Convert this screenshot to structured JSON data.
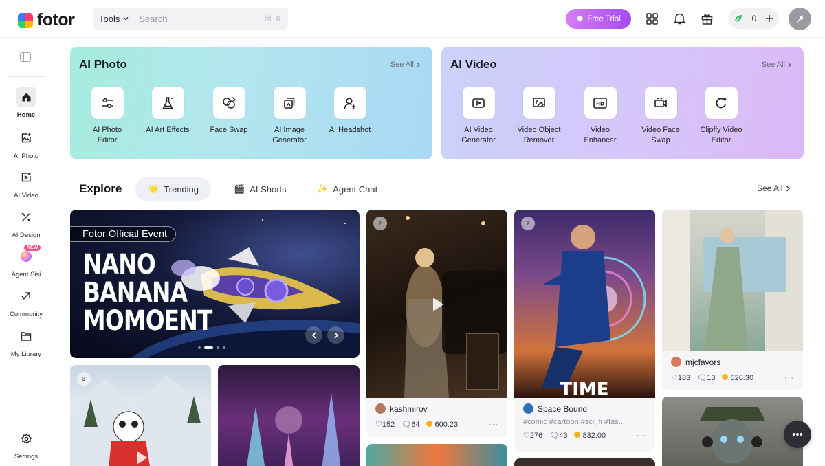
{
  "app": {
    "logo_text": "fotor"
  },
  "topbar": {
    "tools_label": "Tools",
    "search_placeholder": "Search",
    "search_shortcut": "⌘+K",
    "free_trial_label": "Free Trial",
    "credits": "0"
  },
  "sidebar": {
    "items": [
      {
        "label": "Home",
        "icon": "home-icon",
        "active": true
      },
      {
        "label": "AI Photo",
        "icon": "image-plus-icon"
      },
      {
        "label": "AI Video",
        "icon": "video-plus-icon"
      },
      {
        "label": "AI Design",
        "icon": "design-tools-icon"
      },
      {
        "label": "Agent Sisi",
        "icon": "agent-orb-icon",
        "badge": "NEW"
      },
      {
        "label": "Community",
        "icon": "community-icon"
      },
      {
        "label": "My Library",
        "icon": "folder-icon"
      }
    ],
    "settings_label": "Settings"
  },
  "ai_photo": {
    "title": "AI Photo",
    "see_all": "See All",
    "tools": [
      {
        "line1": "AI Photo",
        "line2": "Editor",
        "icon": "sliders-icon"
      },
      {
        "line1": "AI Art Effects",
        "line2": "",
        "icon": "flask-icon"
      },
      {
        "line1": "Face Swap",
        "line2": "",
        "icon": "face-swap-icon"
      },
      {
        "line1": "AI Image",
        "line2": "Generator",
        "icon": "image-generator-icon"
      },
      {
        "line1": "AI Headshot",
        "line2": "",
        "icon": "user-plus-icon"
      }
    ]
  },
  "ai_video": {
    "title": "AI Video",
    "see_all": "See All",
    "tools": [
      {
        "line1": "AI Video",
        "line2": "Generator",
        "icon": "video-generator-icon"
      },
      {
        "line1": "Video Object",
        "line2": "Remover",
        "icon": "eraser-icon"
      },
      {
        "line1": "Video",
        "line2": "Enhancer",
        "icon": "hd-icon"
      },
      {
        "line1": "Video Face",
        "line2": "Swap",
        "icon": "video-swap-icon"
      },
      {
        "line1": "Clipfly Video",
        "line2": "Editor",
        "icon": "clipfly-icon"
      }
    ]
  },
  "explore": {
    "title": "Explore",
    "tabs": [
      {
        "label": "Trending",
        "icon": "sparkle-emoji-icon",
        "active": true
      },
      {
        "label": "AI Shorts",
        "icon": "clapper-icon"
      },
      {
        "label": "Agent Chat",
        "icon": "sparkles-icon"
      }
    ],
    "see_all": "See All"
  },
  "hero": {
    "tag": "Fotor Official Event",
    "title_lines": [
      "NANO",
      "BANANA",
      "MOMOENT"
    ],
    "slide_count": 4,
    "active_slide": 2
  },
  "cards": [
    {
      "author": "kashmirov",
      "likes": "152",
      "comments": "64",
      "points": "600.23",
      "medal": "2"
    },
    {
      "author": "Space Bound",
      "tags": "#comic #cartoon #sci_fi #fas...",
      "likes": "276",
      "comments": "43",
      "points": "832.00",
      "medal": "2",
      "poster_text": "TIME"
    },
    {
      "author": "mjcfavors",
      "likes": "183",
      "comments": "13",
      "points": "526.30"
    },
    {
      "medal": "3"
    }
  ]
}
